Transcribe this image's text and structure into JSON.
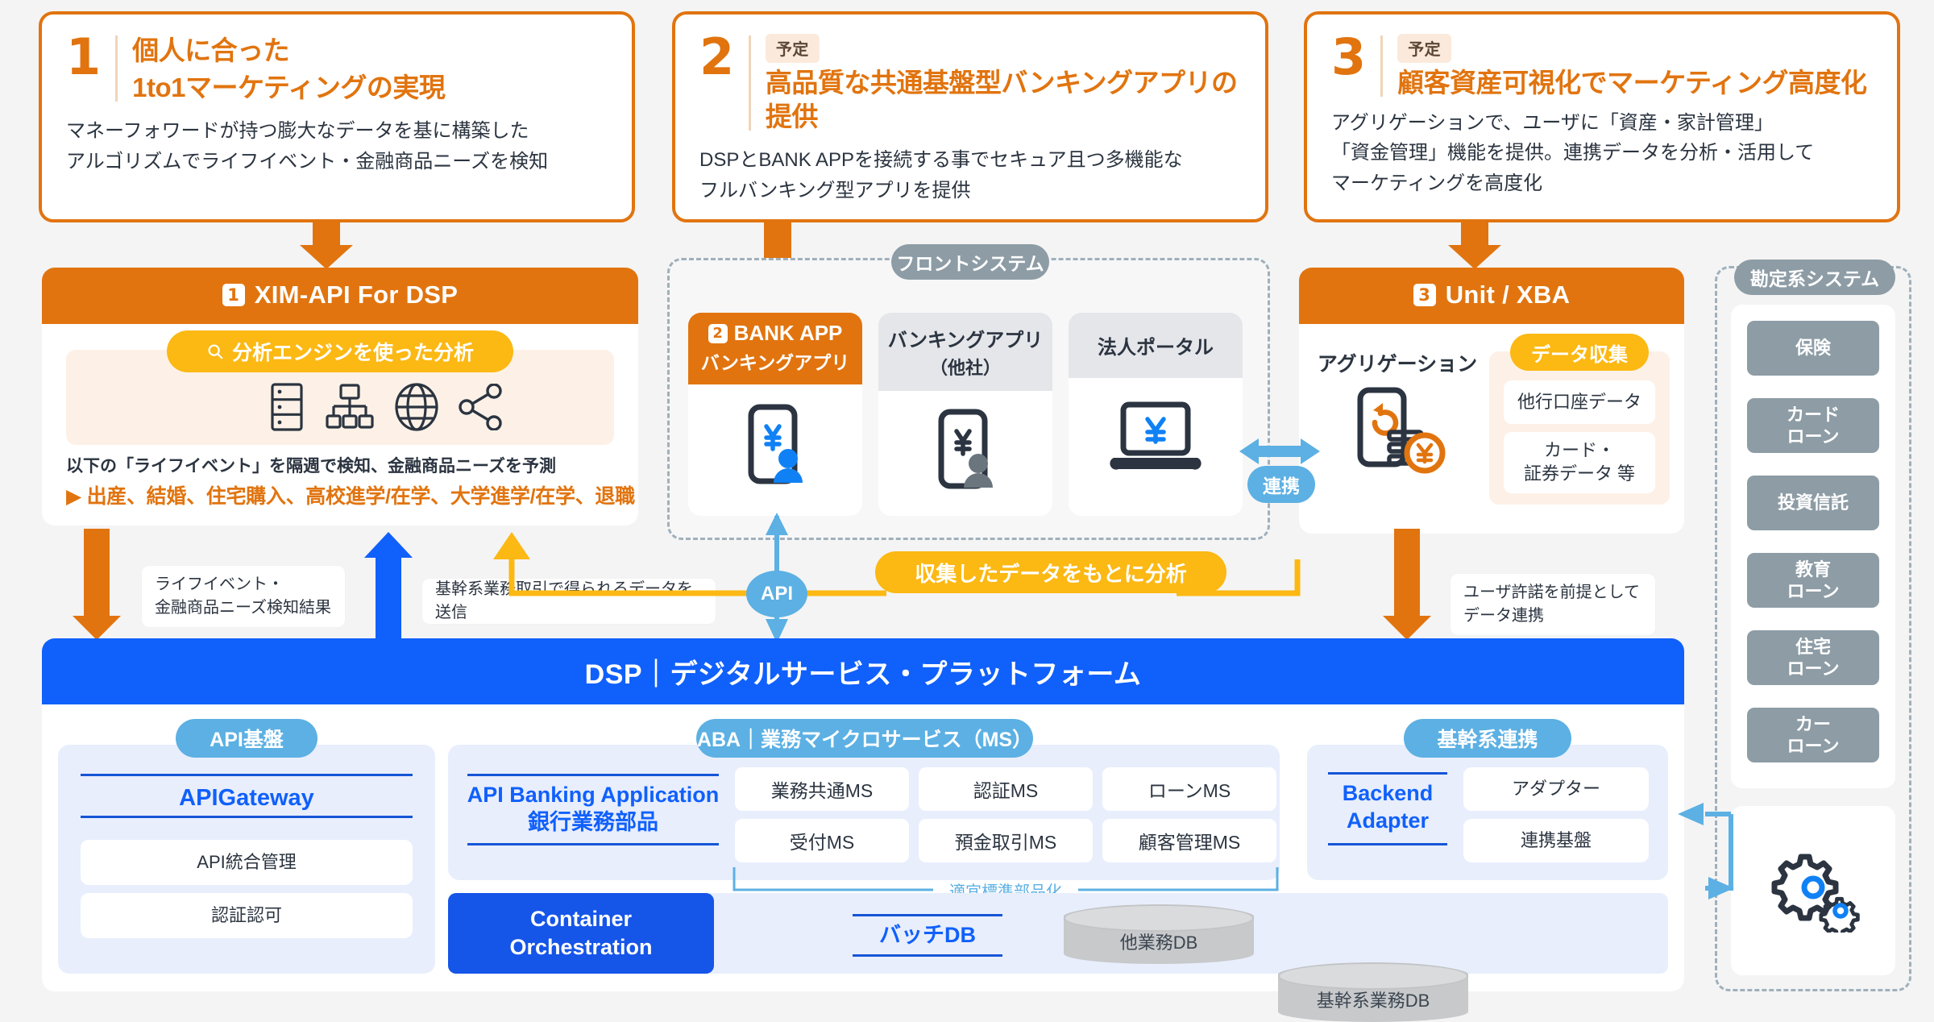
{
  "features": [
    {
      "number": "1",
      "badge": "",
      "title_line1": "個人に合った",
      "title_line2": "1to1マーケティングの実現",
      "body_line1": "マネーフォワードが持つ膨大なデータを基に構築した",
      "body_line2": "アルゴリズムでライフイベント・金融商品ニーズを検知",
      "body_line3": ""
    },
    {
      "number": "2",
      "badge": "予定",
      "title_line1": "",
      "title_line2": "高品質な共通基盤型バンキングアプリの提供",
      "body_line1": "DSPとBANK APPを接続する事でセキュア且つ多機能な",
      "body_line2": "フルバンキング型アプリを提供",
      "body_line3": ""
    },
    {
      "number": "3",
      "badge": "予定",
      "title_line1": "",
      "title_line2": "顧客資産可視化でマーケティング高度化",
      "body_line1": "アグリゲーションで、ユーザに「資産・家計管理」",
      "body_line2": "「資金管理」機能を提供。連携データを分析・活用して",
      "body_line3": "マーケティングを高度化"
    }
  ],
  "xim_panel": {
    "number": "1",
    "title": "XIM-API For DSP",
    "engine_pill": "分析エンジンを使った分析",
    "engine_pill_icon": "search-icon",
    "icons": [
      "server-rack-icon",
      "sitemap-icon",
      "globe-icon",
      "share-nodes-icon"
    ],
    "note_line1": "以下の「ライフイベント」を隔週で検知、金融商品ニーズを予測",
    "note_line2": "▶ 出産、結婚、住宅購入、高校進学/在学、大学進学/在学、退職"
  },
  "front_system": {
    "group_label": "フロントシステム",
    "apps": [
      {
        "badge_number": "2",
        "title": "BANK APP",
        "subtitle": "バンキングアプリ",
        "accent": true,
        "icon": "phone-yen-user-icon"
      },
      {
        "badge_number": "",
        "title": "バンキングアプリ",
        "subtitle": "（他社）",
        "accent": false,
        "icon": "phone-yen-user-icon"
      },
      {
        "badge_number": "",
        "title": "法人ポータル",
        "subtitle": "",
        "accent": false,
        "icon": "laptop-yen-icon"
      }
    ]
  },
  "unit_panel": {
    "number": "3",
    "title": "Unit / XBA",
    "aggregation_label": "アグリゲーション",
    "aggregation_icon": "phone-coins-yen-icon",
    "collect_pill": "データ収集",
    "collect_items": [
      "他行口座データ",
      "カード・\n証券データ 等"
    ]
  },
  "linkage_badge": "連携",
  "core_system": {
    "group_label": "勘定系システム",
    "items": [
      "保険",
      "カード\nローン",
      "投資信託",
      "教育\nローン",
      "住宅\nローン",
      "カー\nローン"
    ],
    "gear_icon": "gears-icon"
  },
  "connectors": {
    "life_event_result": "ライフイベント・\n金融商品ニーズ検知結果",
    "core_tx_send": "基幹系業務取引で得られるデータを送信",
    "api_badge": "API",
    "analyze_pill": "収集したデータをもとに分析",
    "user_consent": "ユーザ許諾を前提として\nデータ連携"
  },
  "dsp": {
    "banner": "DSP｜デジタルサービス・プラットフォーム",
    "groups": [
      {
        "pill": "API基盤",
        "heading": "APIGateway",
        "heading_sub": "",
        "items": [
          "API統合管理",
          "認証認可"
        ]
      },
      {
        "pill": "ABA｜業務マイクロサービス（MS）",
        "heading": "API Banking Application",
        "heading_sub": "銀行業務部品",
        "items": [
          "業務共通MS",
          "認証MS",
          "ローンMS",
          "受付MS",
          "預金取引MS",
          "顧客管理MS"
        ],
        "bracket_label": "適宜標準部品化"
      },
      {
        "pill": "基幹系連携",
        "heading": "Backend",
        "heading_sub": "Adapter",
        "items": [
          "アダプター",
          "連携基盤"
        ]
      }
    ],
    "container_orchestration_line1": "Container",
    "container_orchestration_line2": "Orchestration",
    "batch_db_label": "バッチDB",
    "databases": [
      "他業務DB",
      "基幹系業務DB"
    ]
  },
  "colors": {
    "orange": "#e1740f",
    "blue": "#1060fb",
    "light_blue": "#5cb0e3",
    "yellow": "#fcb813",
    "gray": "#8d9ca5",
    "panel_blue": "#e8eefc",
    "cream": "#fdf1e7"
  }
}
